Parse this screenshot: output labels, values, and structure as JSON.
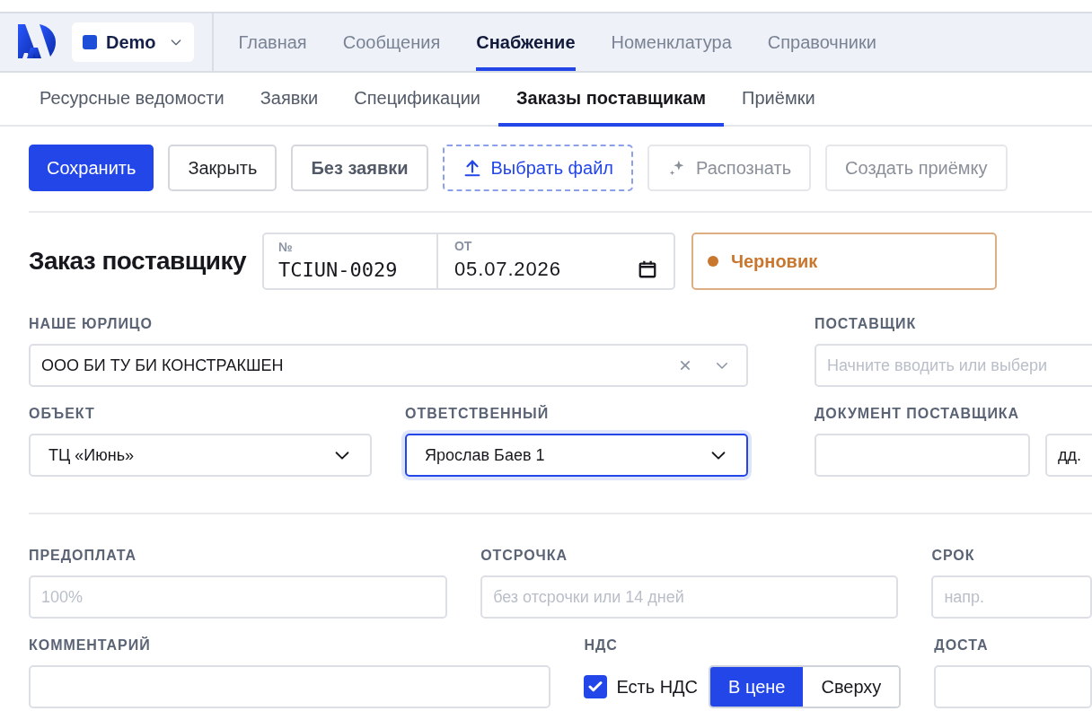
{
  "workspace": {
    "name": "Demo",
    "color": "#1d4ed8"
  },
  "nav_tabs": [
    {
      "label": "Главная",
      "selected": false
    },
    {
      "label": "Сообщения",
      "selected": false
    },
    {
      "label": "Снабжение",
      "selected": true
    },
    {
      "label": "Номенклатура",
      "selected": false
    },
    {
      "label": "Справочники",
      "selected": false
    }
  ],
  "sub_tabs": [
    {
      "label": "Ресурсные ведомости",
      "selected": false
    },
    {
      "label": "Заявки",
      "selected": false
    },
    {
      "label": "Спецификации",
      "selected": false
    },
    {
      "label": "Заказы поставщикам",
      "selected": true
    },
    {
      "label": "Приёмки",
      "selected": false
    }
  ],
  "toolbar": [
    {
      "label": "Сохранить",
      "kind": "primary",
      "disabled": false
    },
    {
      "label": "Закрыть",
      "kind": "plain",
      "disabled": false
    },
    {
      "label": "Без заявки",
      "kind": "strong",
      "disabled": false
    },
    {
      "label": "Выбрать файл",
      "kind": "upload",
      "disabled": false
    },
    {
      "label": "Распознать",
      "kind": "sparkle",
      "disabled": true
    },
    {
      "label": "Создать приёмку",
      "kind": "plain",
      "disabled": true
    }
  ],
  "header": {
    "title": "Заказ поставщику",
    "number_label": "№",
    "number": "TCIUN-0029",
    "date_label": "ОТ",
    "date": "05.07.2026",
    "status": {
      "label": "Черновик",
      "color": "#c9772f"
    }
  },
  "legal_entity": {
    "label": "НАШЕ ЮРЛИЦО",
    "value": "ООО БИ ТУ БИ КОНСТРАКШЕН"
  },
  "object": {
    "label": "ОБЪЕКТ",
    "value": "ТЦ «Июнь»",
    "focused": false
  },
  "responsible": {
    "label": "ОТВЕТСТВЕННЫЙ",
    "value": "Ярослав Баев 1",
    "focused": true
  },
  "supplier": {
    "label": "ПОСТАВЩИК",
    "placeholder": "Начните вводить или выбери"
  },
  "supplier_document": {
    "label": "ДОКУМЕНТ ПОСТАВЩИКА",
    "date_placeholder": "дд."
  },
  "prepayment": {
    "label": "ПРЕДОПЛАТА",
    "placeholder": "100%"
  },
  "deferral": {
    "label": "ОТСРОЧКА",
    "placeholder": "без отсрочки или 14 дней"
  },
  "term": {
    "label": "СРОК",
    "placeholder": "напр."
  },
  "comment": {
    "label": "КОММЕНТАРИЙ"
  },
  "vat": {
    "label": "НДС",
    "checkbox_label": "Есть НДС",
    "checked": true,
    "modes": [
      {
        "label": "В цене",
        "selected": true
      },
      {
        "label": "Сверху",
        "selected": false
      }
    ]
  },
  "delivery": {
    "label": "ДОСТА"
  }
}
